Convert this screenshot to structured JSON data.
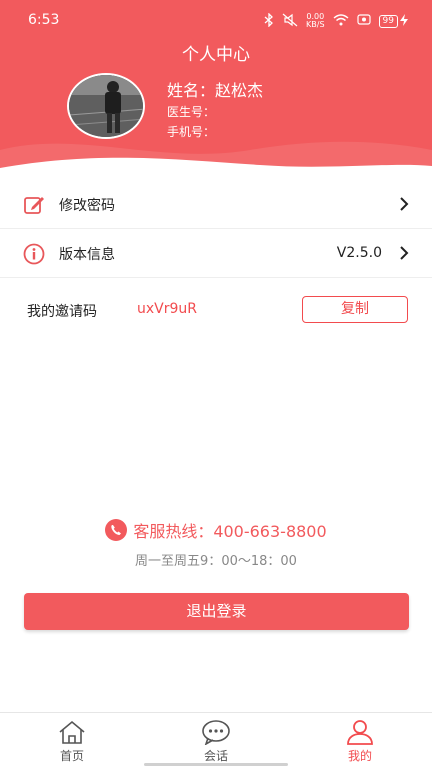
{
  "status_bar": {
    "time": "6:53",
    "net_speed_top": "0.00",
    "net_speed_bottom": "KB/S",
    "battery": "99",
    "icons": [
      "bluetooth-icon",
      "mute-icon",
      "wifi-icon",
      "screen-record-icon",
      "charging-icon"
    ]
  },
  "header": {
    "title": "个人中心",
    "name_label": "姓名：赵松杰",
    "doctor_no_label": "医生号：",
    "phone_label": "手机号："
  },
  "menu": {
    "change_password": "修改密码",
    "version_label": "版本信息",
    "version_value": "V2.5.0"
  },
  "invite": {
    "label": "我的邀请码",
    "code": "uxVr9uR",
    "copy_button": "复制"
  },
  "hotline": {
    "text": "客服热线：400-663-8800",
    "hours": "周一至周五9：00～18：00"
  },
  "logout_button": "退出登录",
  "nav": {
    "home": "首页",
    "chat": "会话",
    "mine": "我的",
    "active": "mine"
  },
  "colors": {
    "brand": "#f25a5d",
    "accent": "#f24b4e"
  }
}
